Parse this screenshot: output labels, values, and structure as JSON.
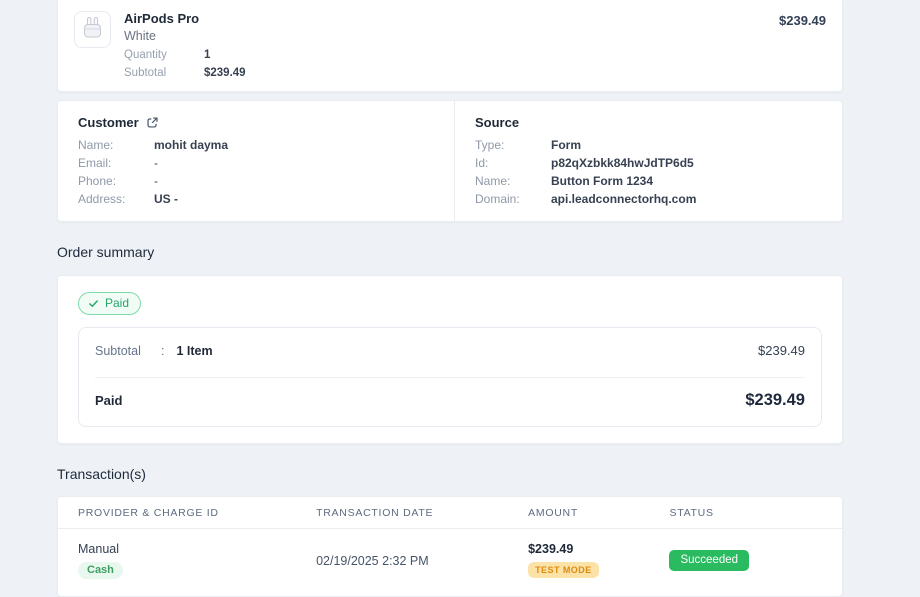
{
  "colors": {
    "page_bg": "#eef2f6",
    "link_blue": "#2a6af5",
    "paid_green": "#27a567",
    "cash_badge_green": "#3f9f63",
    "succeeded_green": "#2abb60",
    "test_mode_orange": "#dd8c10"
  },
  "product_card": {
    "name": "AirPods Pro",
    "variant": "White",
    "rows": [
      {
        "label": "Quantity",
        "value": "1"
      },
      {
        "label": "Subtotal",
        "value": "$239.49"
      }
    ],
    "price": "$239.49"
  },
  "customer": {
    "title": "Customer",
    "rows": [
      {
        "label": "Name:",
        "value": "mohit dayma"
      },
      {
        "label": "Email:",
        "value": "-"
      },
      {
        "label": "Phone:",
        "value": "-"
      },
      {
        "label": "Address:",
        "value": "US -"
      }
    ]
  },
  "source": {
    "title": "Source",
    "rows": [
      {
        "label": "Type:",
        "value": "Form"
      },
      {
        "label": "Id:",
        "value": "p82qXzbkk84hwJdTP6d5"
      },
      {
        "label": "Name:",
        "value": "Button Form 1234"
      },
      {
        "label": "Domain:",
        "value": "api.leadconnectorhq.com"
      }
    ]
  },
  "order_summary": {
    "heading": "Order summary",
    "status_badge": "Paid",
    "subtotal_label": "Subtotal",
    "subtotal_colon": ":",
    "subtotal_items": "1 Item",
    "subtotal_amount": "$239.49",
    "paid_label": "Paid",
    "paid_amount": "$239.49"
  },
  "transactions": {
    "heading": "Transaction(s)",
    "columns": [
      "PROVIDER & CHARGE ID",
      "TRANSACTION DATE",
      "AMOUNT",
      "STATUS"
    ],
    "row": {
      "provider": "Manual",
      "method": "Cash",
      "date": "02/19/2025 2:32 PM",
      "amount": "$239.49",
      "mode_badge": "TEST MODE",
      "status": "Succeeded"
    }
  }
}
